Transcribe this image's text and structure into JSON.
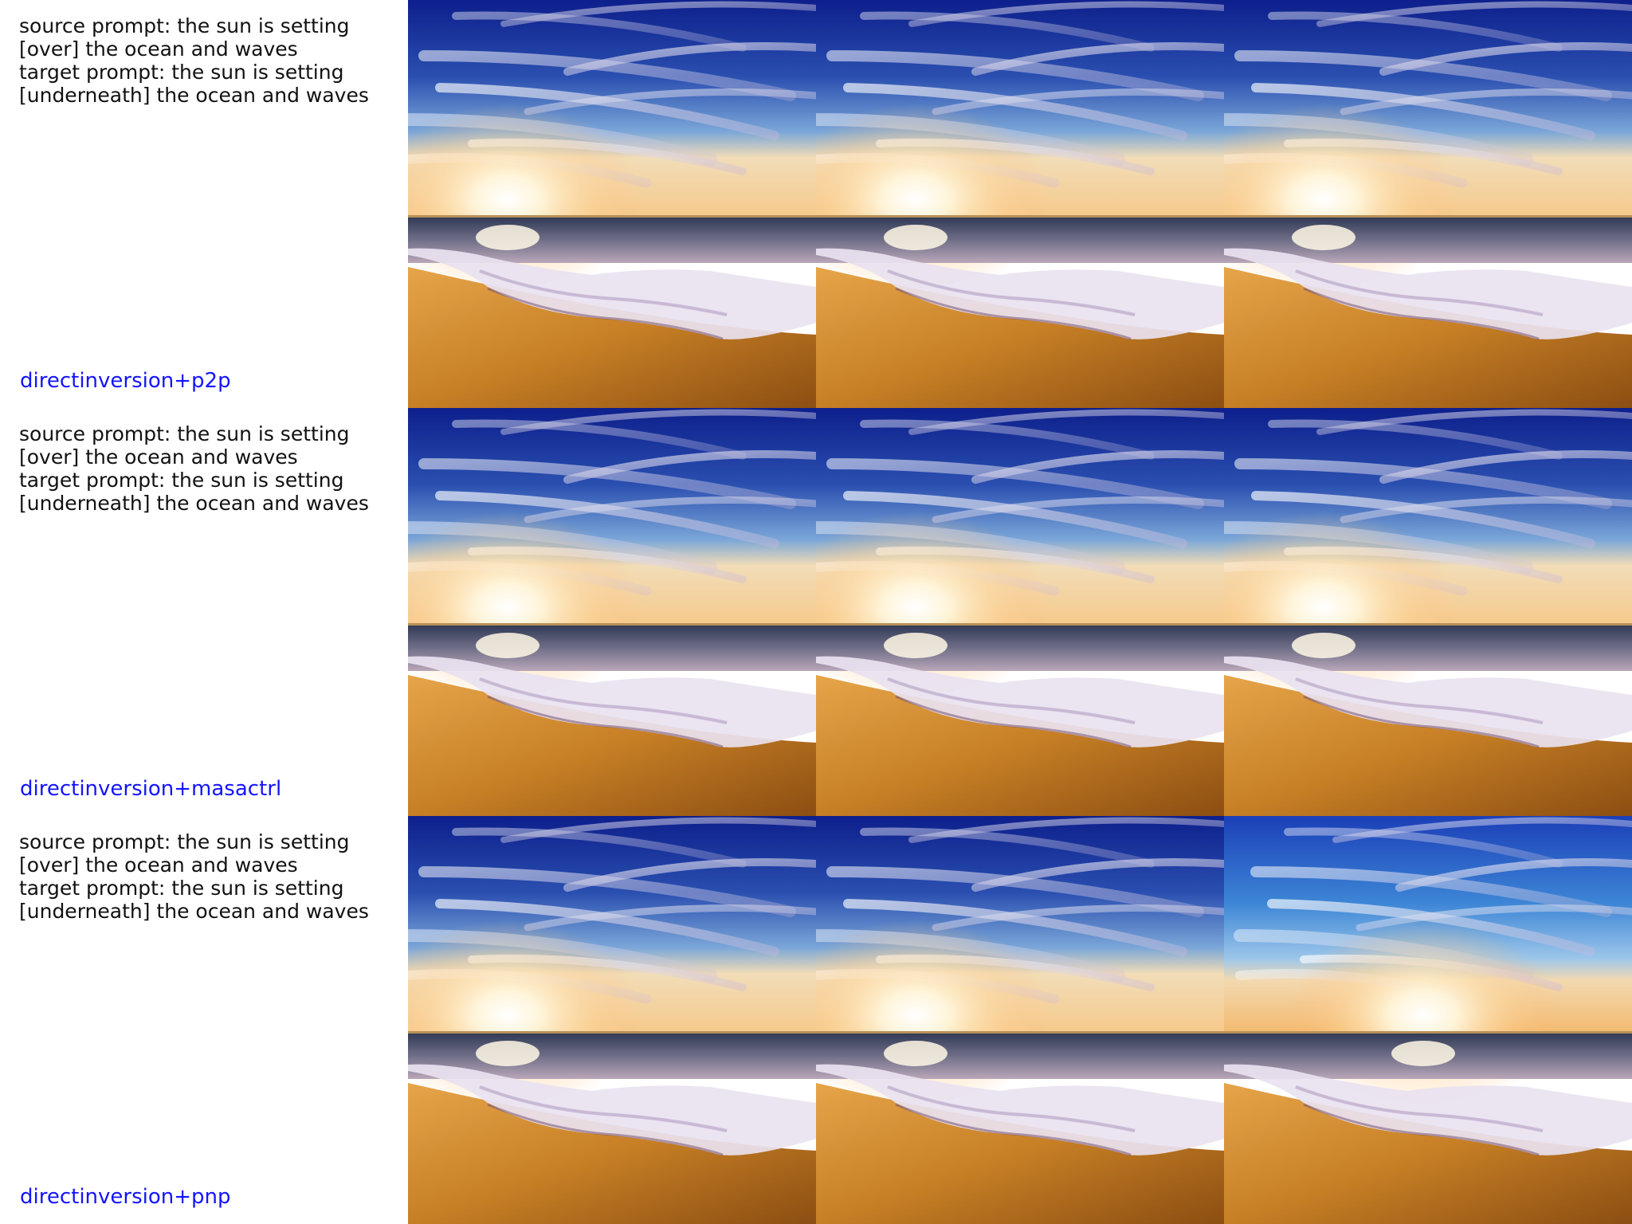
{
  "rows": [
    {
      "prompt_lines": [
        "source prompt: the sun is setting",
        "[over] the ocean and waves",
        "target prompt: the sun is setting",
        "[underneath] the ocean and waves"
      ],
      "method": "directinversion+p2p"
    },
    {
      "prompt_lines": [
        "source prompt: the sun is setting",
        "[over] the ocean and waves",
        "target prompt: the sun is setting",
        "[underneath] the ocean and waves"
      ],
      "method": "directinversion+masactrl"
    },
    {
      "prompt_lines": [
        "source prompt: the sun is setting",
        "[over] the ocean and waves",
        "target prompt: the sun is setting",
        "[underneath] the ocean and waves"
      ],
      "method": "directinversion+pnp"
    }
  ],
  "colors": {
    "method_label": "#1414ff",
    "sky_top": "#0d1f8c",
    "sky_mid": "#2a5fbf",
    "sun_glow": "#fff6dc",
    "sand": "#c8862a",
    "foam": "#e9e2f0"
  }
}
